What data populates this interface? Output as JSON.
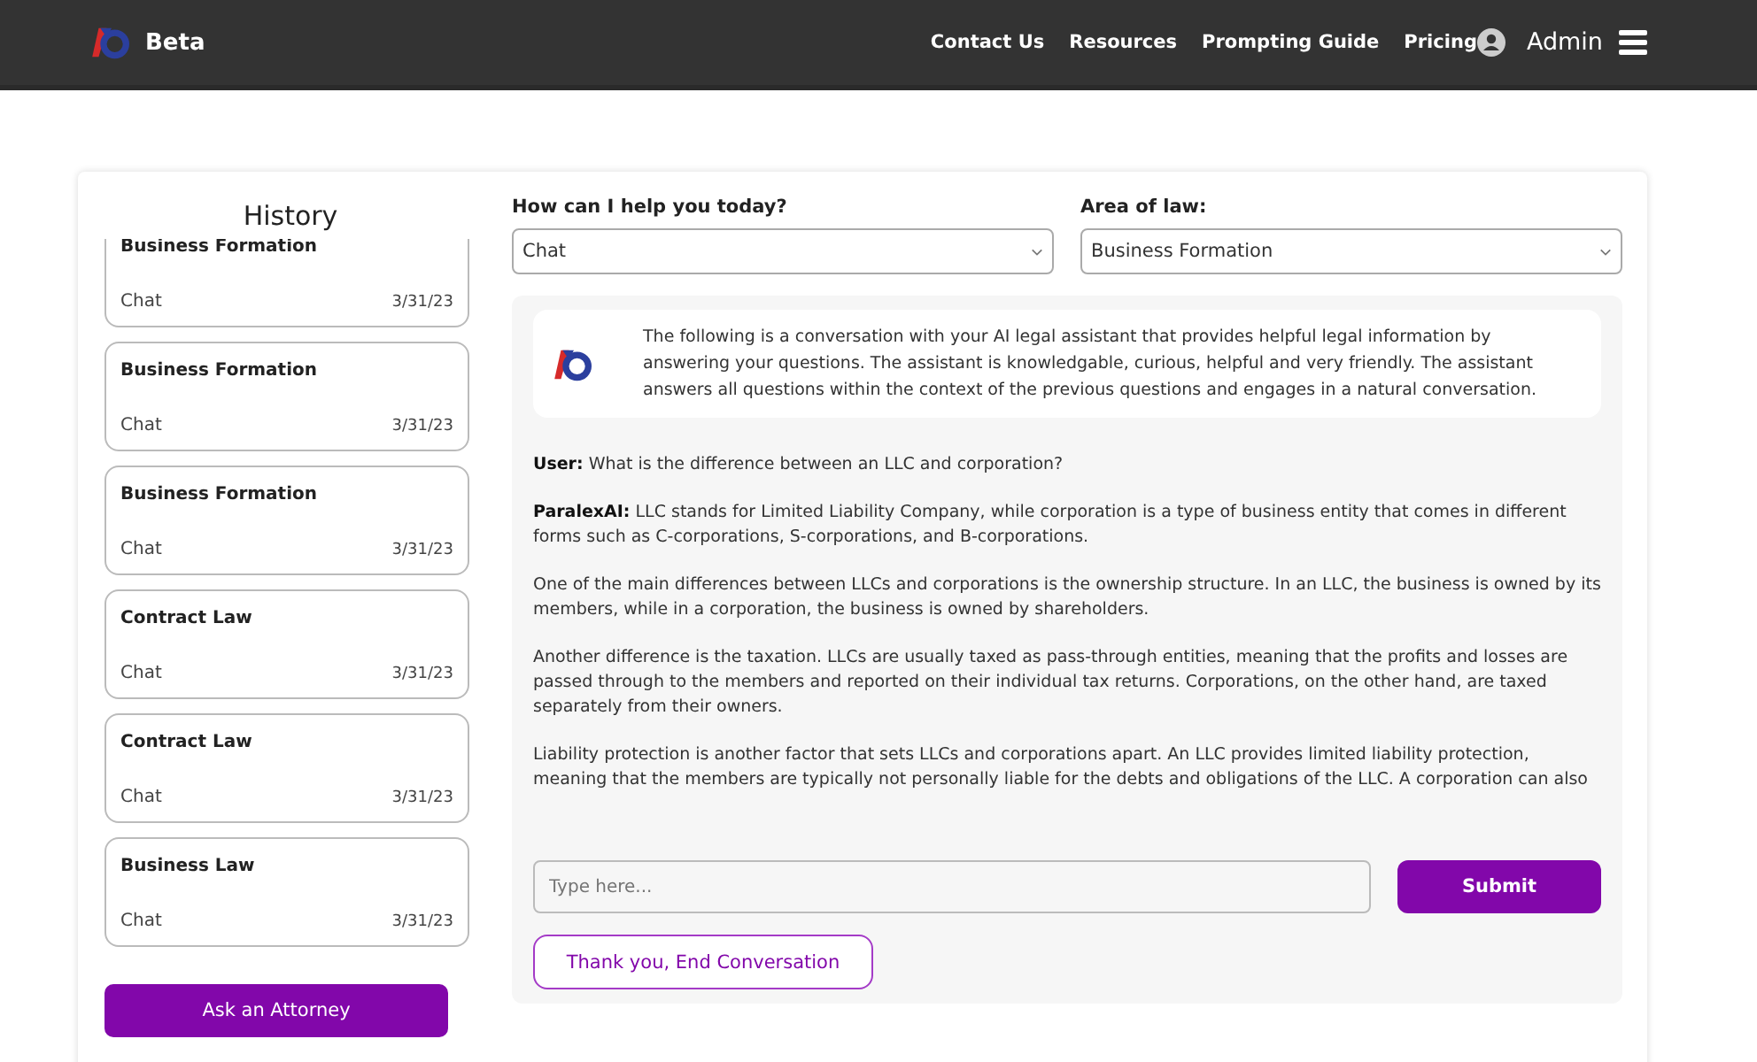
{
  "header": {
    "brand": "Beta",
    "nav": [
      "Contact Us",
      "Resources",
      "Prompting Guide",
      "Pricing"
    ],
    "user": "Admin"
  },
  "history": {
    "title": "History",
    "items": [
      {
        "topic": "Business Formation",
        "type": "Chat",
        "date": "3/31/23"
      },
      {
        "topic": "Business Formation",
        "type": "Chat",
        "date": "3/31/23"
      },
      {
        "topic": "Business Formation",
        "type": "Chat",
        "date": "3/31/23"
      },
      {
        "topic": "Contract Law",
        "type": "Chat",
        "date": "3/31/23"
      },
      {
        "topic": "Contract Law",
        "type": "Chat",
        "date": "3/31/23"
      },
      {
        "topic": "Business Law",
        "type": "Chat",
        "date": "3/31/23"
      }
    ],
    "button": "Ask an Attorney"
  },
  "selects": [
    {
      "label": "How can I help you today?",
      "value": "Chat"
    },
    {
      "label": "Area of law:",
      "value": "Business Formation"
    }
  ],
  "intro": "The following is a conversation with your AI legal assistant that provides helpful legal information by answering your questions. The assistant is knowledgable, curious, helpful and very friendly. The assistant answers all questions within the context of the previous questions and engages in a natural conversation.",
  "messages": [
    "**User:**  What is the difference between an LLC and corporation?",
    "**ParalexAI:**  LLC stands for Limited Liability Company, while corporation is a type of business entity that comes in different forms such as C-corporations, S-corporations, and B-corporations.",
    "One of the main differences between LLCs and corporations is the ownership structure. In an LLC, the business is owned by its members, while in a corporation, the business is owned by shareholders.",
    "Another difference is the taxation. LLCs are usually taxed as pass-through entities, meaning that the profits and losses are passed through to the members and reported on their individual tax returns. Corporations, on the other hand, are taxed separately from their owners.",
    "Liability protection is another factor that sets LLCs and corporations apart. An LLC provides limited liability protection, meaning that the members are typically not personally liable for the debts and obligations of the LLC. A corporation can also"
  ],
  "input": {
    "placeholder": "Type here..."
  },
  "submit": "Submit",
  "end_button": "Thank you, End Conversation"
}
